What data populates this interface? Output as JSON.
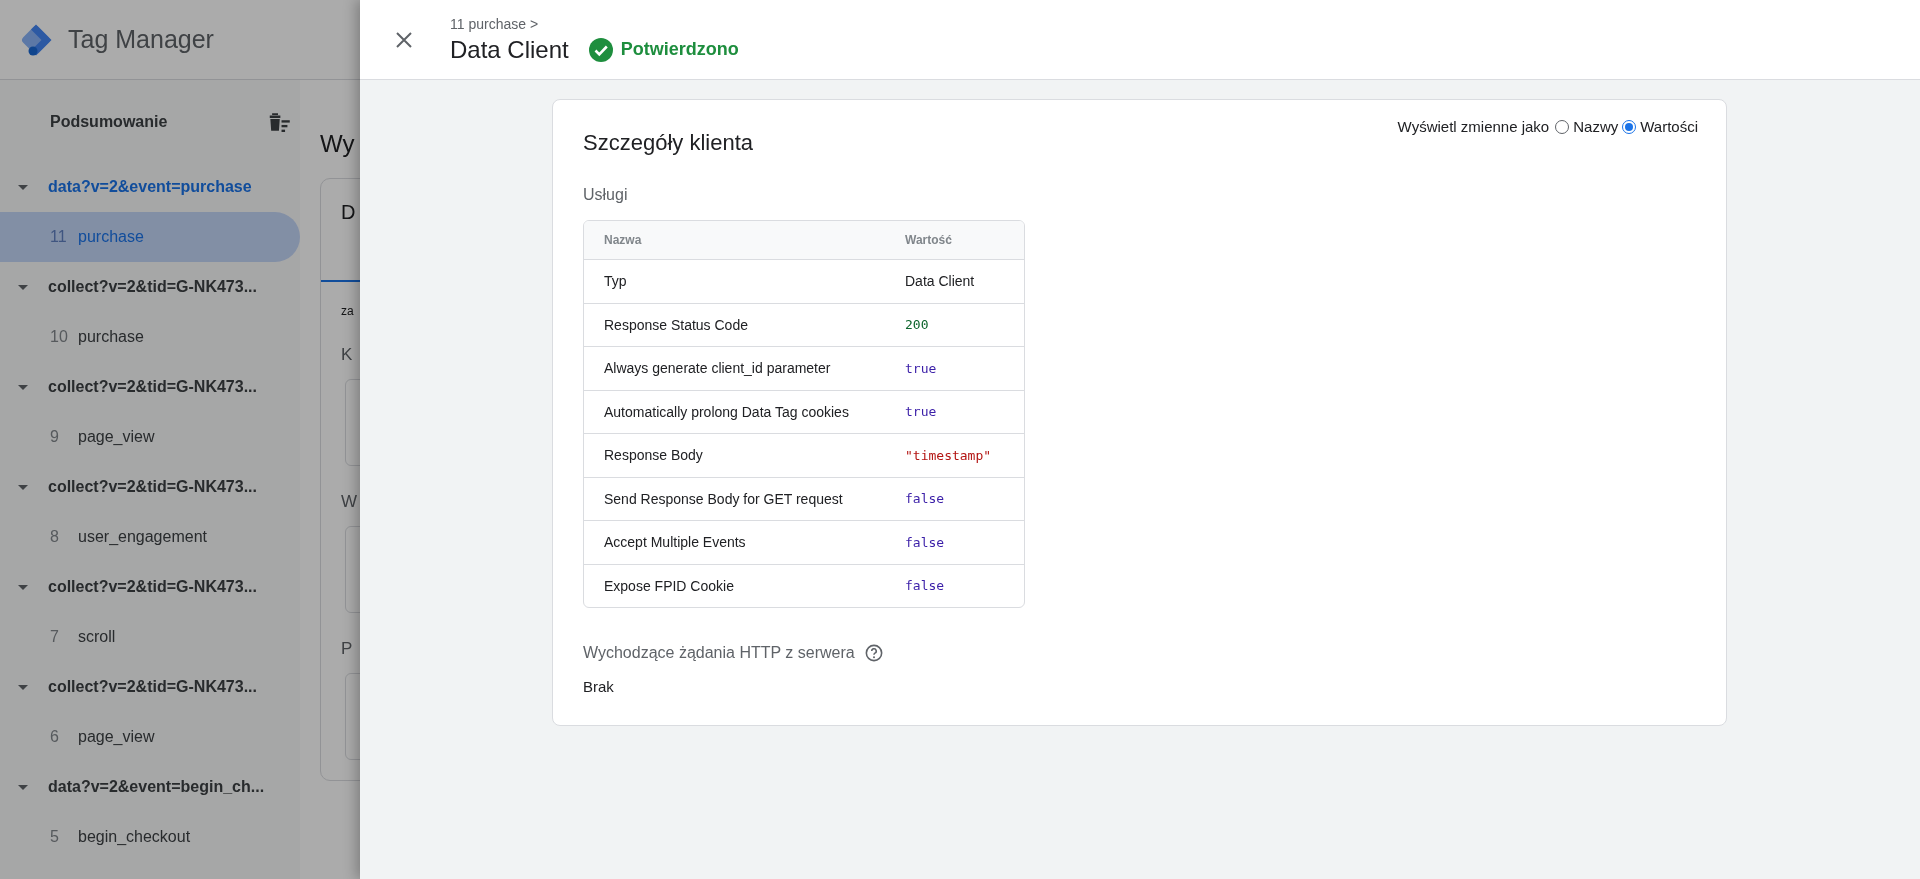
{
  "app": {
    "title": "Tag Manager"
  },
  "sidebar": {
    "summary": "Podsumowanie",
    "groups": [
      {
        "label": "data?v=2&event=purchase",
        "expanded": true,
        "children": [
          {
            "number": "11",
            "name": "purchase",
            "selected": true
          }
        ]
      },
      {
        "label": "collect?v=2&tid=G-NK473...",
        "expanded": true,
        "children": [
          {
            "number": "10",
            "name": "purchase",
            "selected": false
          }
        ]
      },
      {
        "label": "collect?v=2&tid=G-NK473...",
        "expanded": true,
        "children": [
          {
            "number": "9",
            "name": "page_view",
            "selected": false
          }
        ]
      },
      {
        "label": "collect?v=2&tid=G-NK473...",
        "expanded": true,
        "children": [
          {
            "number": "8",
            "name": "user_engagement",
            "selected": false
          }
        ]
      },
      {
        "label": "collect?v=2&tid=G-NK473...",
        "expanded": true,
        "children": [
          {
            "number": "7",
            "name": "scroll",
            "selected": false
          }
        ]
      },
      {
        "label": "collect?v=2&tid=G-NK473...",
        "expanded": true,
        "children": [
          {
            "number": "6",
            "name": "page_view",
            "selected": false
          }
        ]
      },
      {
        "label": "data?v=2&event=begin_ch...",
        "expanded": true,
        "children": [
          {
            "number": "5",
            "name": "begin_checkout",
            "selected": false
          }
        ]
      }
    ]
  },
  "main": {
    "heading": "Wy",
    "tab": "D",
    "subtitle": "za",
    "sections": [
      "K",
      "W",
      "P"
    ]
  },
  "drawer": {
    "breadcrumb": "11 purchase >",
    "title": "Data Client",
    "status": {
      "kind": "confirmed",
      "label": "Potwierdzono"
    },
    "card": {
      "title": "Szczegóły klienta",
      "view_as": {
        "label": "Wyświetl zmienne jako",
        "options": [
          {
            "label": "Nazwy",
            "selected": false
          },
          {
            "label": "Wartości",
            "selected": true
          }
        ]
      },
      "services": {
        "title": "Usługi",
        "columns": [
          "Nazwa",
          "Wartość"
        ],
        "rows": [
          {
            "name": "Typ",
            "value": "Data Client",
            "kind": "text"
          },
          {
            "name": "Response Status Code",
            "value": "200",
            "kind": "number"
          },
          {
            "name": "Always generate client_id parameter",
            "value": "true",
            "kind": "boolean"
          },
          {
            "name": "Automatically prolong Data Tag cookies",
            "value": "true",
            "kind": "boolean"
          },
          {
            "name": "Response Body",
            "value": "\"timestamp\"",
            "kind": "string"
          },
          {
            "name": "Send Response Body for GET request",
            "value": "false",
            "kind": "boolean"
          },
          {
            "name": "Accept Multiple Events",
            "value": "false",
            "kind": "boolean"
          },
          {
            "name": "Expose FPID Cookie",
            "value": "false",
            "kind": "boolean"
          }
        ]
      },
      "outgoing": {
        "title": "Wychodzące żądania HTTP z serwera",
        "value": "Brak"
      }
    }
  }
}
